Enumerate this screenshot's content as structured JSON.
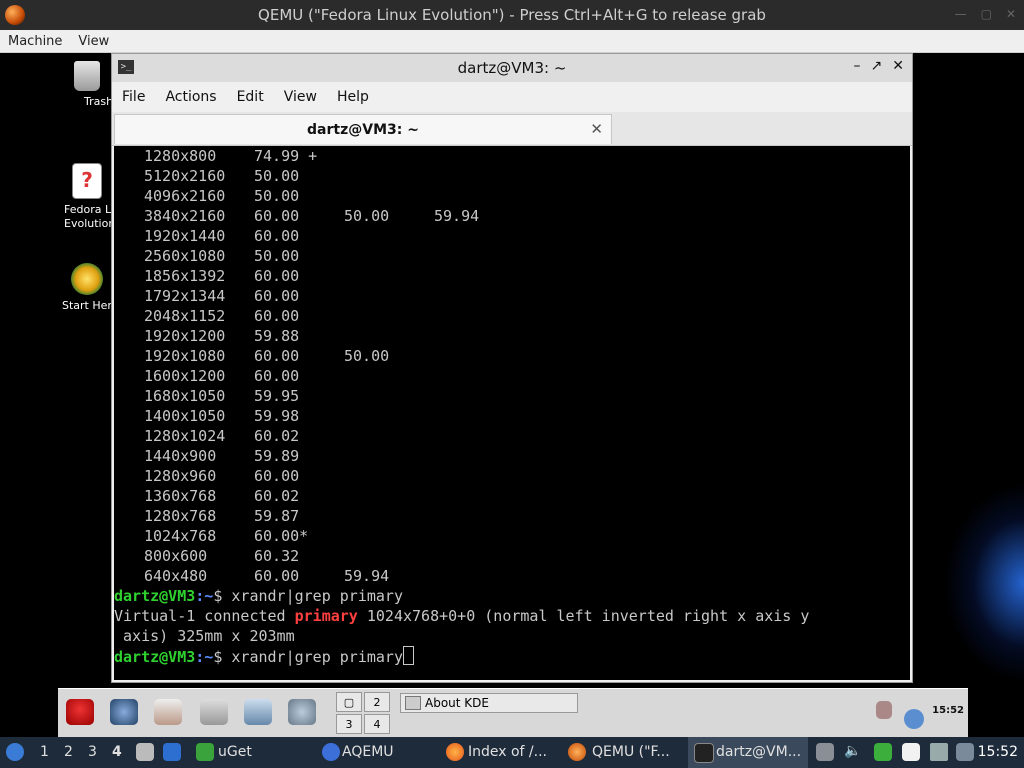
{
  "host": {
    "title": "QEMU (\"Fedora Linux Evolution\") - Press Ctrl+Alt+G to release grab",
    "menu": [
      "Machine",
      "View"
    ]
  },
  "desktop_icons": [
    {
      "label": "Trash",
      "icon": "trash-icon"
    },
    {
      "label": "Fedora L\nEvolution",
      "icon": "help-icon"
    },
    {
      "label": "Start Her",
      "icon": "start-here-icon"
    }
  ],
  "terminal": {
    "title": "dartz@VM3: ~",
    "menu": [
      "File",
      "Actions",
      "Edit",
      "View",
      "Help"
    ],
    "tab": "dartz@VM3: ~",
    "modes": [
      {
        "res": "1280x800",
        "rates": [
          "74.99 +"
        ]
      },
      {
        "res": "5120x2160",
        "rates": [
          "50.00"
        ]
      },
      {
        "res": "4096x2160",
        "rates": [
          "50.00"
        ]
      },
      {
        "res": "3840x2160",
        "rates": [
          "60.00",
          "50.00",
          "59.94"
        ]
      },
      {
        "res": "1920x1440",
        "rates": [
          "60.00"
        ]
      },
      {
        "res": "2560x1080",
        "rates": [
          "50.00"
        ]
      },
      {
        "res": "1856x1392",
        "rates": [
          "60.00"
        ]
      },
      {
        "res": "1792x1344",
        "rates": [
          "60.00"
        ]
      },
      {
        "res": "2048x1152",
        "rates": [
          "60.00"
        ]
      },
      {
        "res": "1920x1200",
        "rates": [
          "59.88"
        ]
      },
      {
        "res": "1920x1080",
        "rates": [
          "60.00",
          "50.00"
        ]
      },
      {
        "res": "1600x1200",
        "rates": [
          "60.00"
        ]
      },
      {
        "res": "1680x1050",
        "rates": [
          "59.95"
        ]
      },
      {
        "res": "1400x1050",
        "rates": [
          "59.98"
        ]
      },
      {
        "res": "1280x1024",
        "rates": [
          "60.02"
        ]
      },
      {
        "res": "1440x900",
        "rates": [
          "59.89"
        ]
      },
      {
        "res": "1280x960",
        "rates": [
          "60.00"
        ]
      },
      {
        "res": "1360x768",
        "rates": [
          "60.02"
        ]
      },
      {
        "res": "1280x768",
        "rates": [
          "59.87"
        ]
      },
      {
        "res": "1024x768",
        "rates": [
          "60.00*"
        ]
      },
      {
        "res": "800x600",
        "rates": [
          "60.32"
        ]
      },
      {
        "res": "640x480",
        "rates": [
          "60.00",
          "59.94"
        ]
      }
    ],
    "prompt_user": "dartz@VM3",
    "prompt_path": ":~",
    "prompt_sign": "$ ",
    "command1": "xrandr|grep primary",
    "output_pre": "Virtual-1 connected ",
    "output_highlight": "primary",
    "output_post": " 1024x768+0+0 (normal left inverted right x axis y",
    "output_wrap": " axis) 325mm x 203mm",
    "command2": "xrandr|grep primary"
  },
  "kde_panel": {
    "pager": [
      "1",
      "2",
      "3",
      "4"
    ],
    "task": "About KDE",
    "clock": "15:52"
  },
  "taskbar": {
    "workspaces": [
      "1",
      "2",
      "3",
      "4"
    ],
    "tasks": [
      "uGet",
      "AQEMU",
      "Index of /...",
      "QEMU (\"F...",
      "dartz@VM..."
    ],
    "clock": "15:52"
  }
}
